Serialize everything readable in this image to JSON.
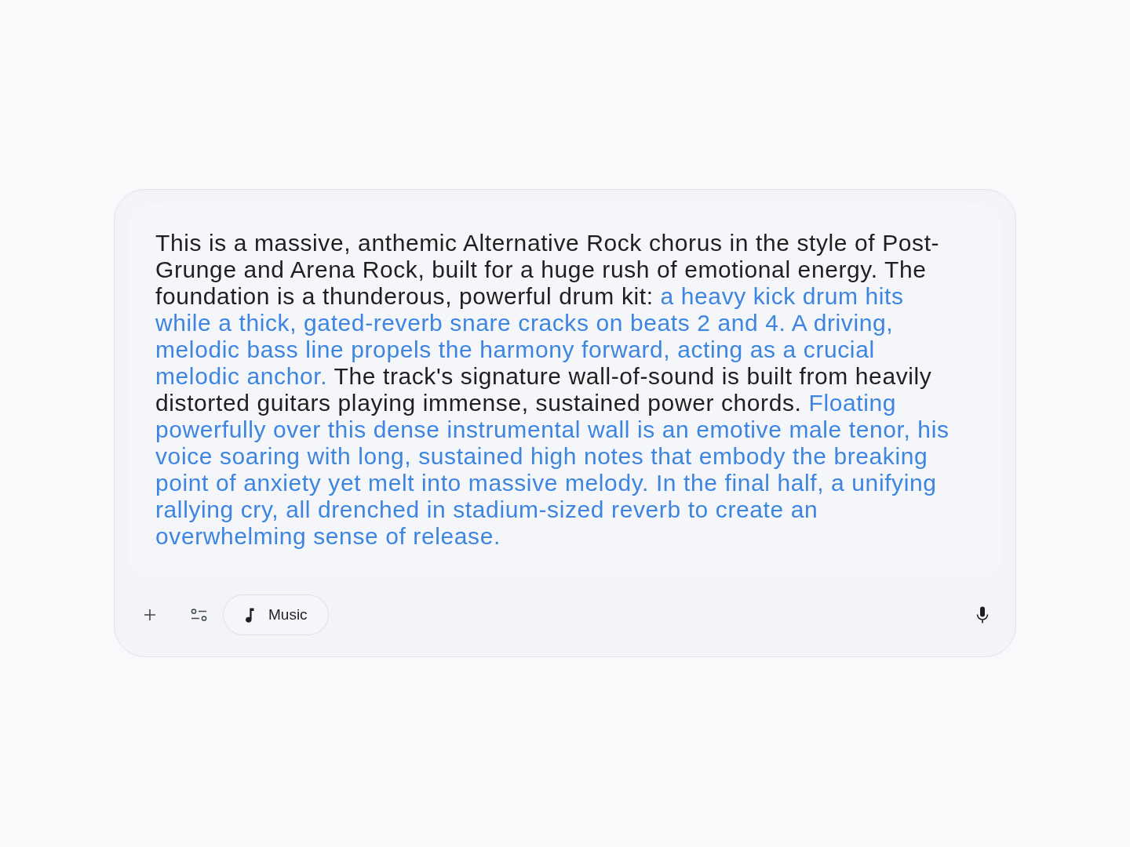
{
  "prompt": {
    "segments": [
      {
        "text": "This is a massive, anthemic Alternative Rock chorus in the style of Post-Grunge and Arena Rock, built for a huge rush of emotional energy. The foundation is a thunderous, powerful drum kit:",
        "highlighted": false
      },
      {
        "text": "a heavy kick drum hits while a thick, gated-reverb snare cracks on beats 2 and 4. A driving, melodic bass line propels the harmony forward, acting as a crucial melodic anchor.",
        "highlighted": true
      },
      {
        "text": "The track's signature wall-of-sound is built from heavily distorted guitars playing immense, sustained power chords.",
        "highlighted": false
      },
      {
        "text": "Floating powerfully over this dense instrumental wall is an emotive male tenor, his voice soaring with long, sustained high notes that embody the breaking point of anxiety yet melt into massive melody. In the final half, a unifying rallying cry, all drenched in stadium-sized reverb to create an overwhelming sense of release.",
        "highlighted": true
      }
    ]
  },
  "toolbar": {
    "chip": {
      "label": "Music"
    }
  }
}
